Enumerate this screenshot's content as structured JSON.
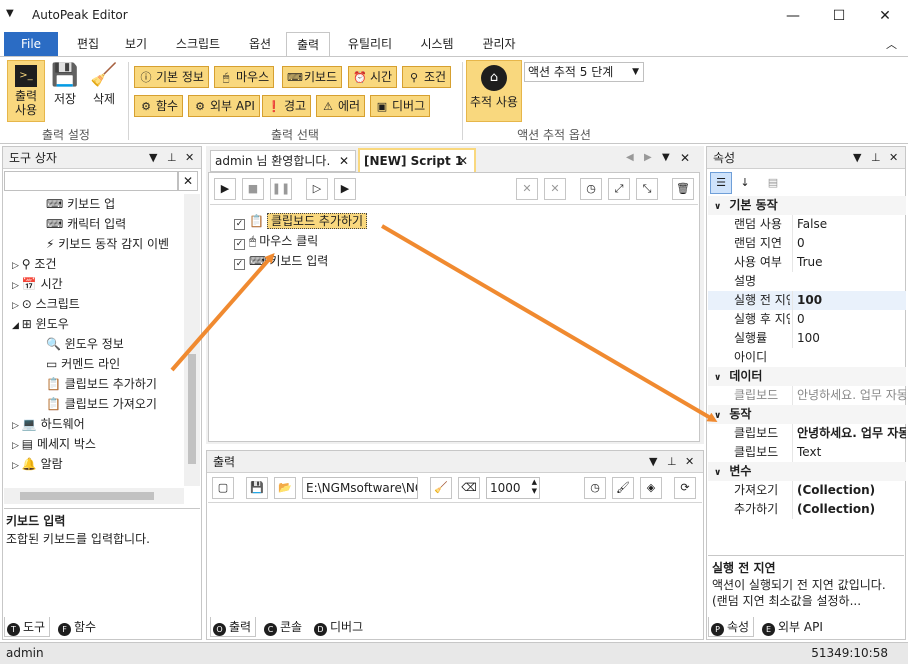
{
  "app": {
    "title": "AutoPeak Editor"
  },
  "ribbon_tabs": [
    "편집",
    "보기",
    "스크립트",
    "옵션",
    "출력",
    "유틸리티",
    "시스템",
    "관리자"
  ],
  "file_tab": "File",
  "ribbon": {
    "output_use": "출력\n사용",
    "save": "저장",
    "delete": "삭제",
    "group_output_settings": "출력 설정",
    "small": [
      "기본 정보",
      "마우스",
      "키보드",
      "시간",
      "조건",
      "함수",
      "외부 API",
      "경고",
      "에러",
      "디버그"
    ],
    "group_output_select": "출력 선택",
    "track_use": "추적 사용",
    "action_track_select": "액션 추적 5 단계",
    "group_action_track": "액션 추적 옵션"
  },
  "toolbox": {
    "title": "도구 상자",
    "items": [
      {
        "label": "키보드 업",
        "icon": "keyboard-icon"
      },
      {
        "label": "캐릭터 입력",
        "icon": "keyboard-icon"
      },
      {
        "label": "키보드 동작 감지 이벤",
        "icon": "lightning-icon"
      },
      {
        "label": "조건",
        "icon": "condition-icon"
      },
      {
        "label": "시간",
        "icon": "calendar-icon"
      },
      {
        "label": "스크립트",
        "icon": "script-icon"
      },
      {
        "label": "윈도우",
        "icon": "windows-icon"
      },
      {
        "label": "윈도우 정보",
        "icon": "search-icon"
      },
      {
        "label": "커멘드 라인",
        "icon": "console-icon"
      },
      {
        "label": "클립보드 추가하기",
        "icon": "clipboard-icon"
      },
      {
        "label": "클립보드 가져오기",
        "icon": "clipboard-icon"
      },
      {
        "label": "하드웨어",
        "icon": "laptop-icon"
      },
      {
        "label": "메세지 박스",
        "icon": "message-icon"
      },
      {
        "label": "알람",
        "icon": "bell-icon"
      }
    ],
    "desc_title": "키보드 입력",
    "desc_text": "조합된 키보드를 입력합니다.",
    "tabs": [
      "도구",
      "함수"
    ]
  },
  "doc_tabs": [
    "admin 님 환영합니다.",
    "[NEW] Script 1"
  ],
  "script_lines": [
    "클립보드 추가하기",
    "마우스 클릭",
    "키보드 입력"
  ],
  "output_panel": {
    "title": "출력",
    "path": "E:\\NGMsoftware\\NG",
    "number": "1000",
    "tabs": [
      "출력",
      "콘솔",
      "디버그"
    ]
  },
  "properties": {
    "title": "속성",
    "categories": [
      {
        "name": "기본 동작",
        "rows": [
          {
            "k": "랜덤 사용",
            "v": "False"
          },
          {
            "k": "랜덤 지연",
            "v": "0"
          },
          {
            "k": "사용 여부",
            "v": "True"
          },
          {
            "k": "설명",
            "v": ""
          },
          {
            "k": "실행 전 지연",
            "v": "100"
          },
          {
            "k": "실행 후 지연",
            "v": "0"
          },
          {
            "k": "실행률",
            "v": "100"
          },
          {
            "k": "아이디",
            "v": ""
          }
        ]
      },
      {
        "name": "데이터",
        "rows": [
          {
            "k": "클립보드",
            "v": "안녕하세요. 업무 자동화"
          }
        ]
      },
      {
        "name": "동작",
        "rows": [
          {
            "k": "클립보드",
            "v": "안녕하세요. 업무 자동화"
          },
          {
            "k": "클립보드",
            "v": "Text"
          }
        ]
      },
      {
        "name": "변수",
        "rows": [
          {
            "k": "가져오기",
            "v": "(Collection)"
          },
          {
            "k": "추가하기",
            "v": "(Collection)"
          }
        ]
      }
    ],
    "desc_title": "실행 전 지연",
    "desc_text": "액션이 실행되기 전 지연 값입니다. (랜덤 지연 최소값을 설정하...",
    "tabs": [
      "속성",
      "외부 API"
    ]
  },
  "status": {
    "user": "admin",
    "time": "51349:10:58"
  },
  "colors": {
    "accent": "#2b6cc4",
    "highlight": "#f9d87e",
    "arrow": "#f08a30"
  }
}
